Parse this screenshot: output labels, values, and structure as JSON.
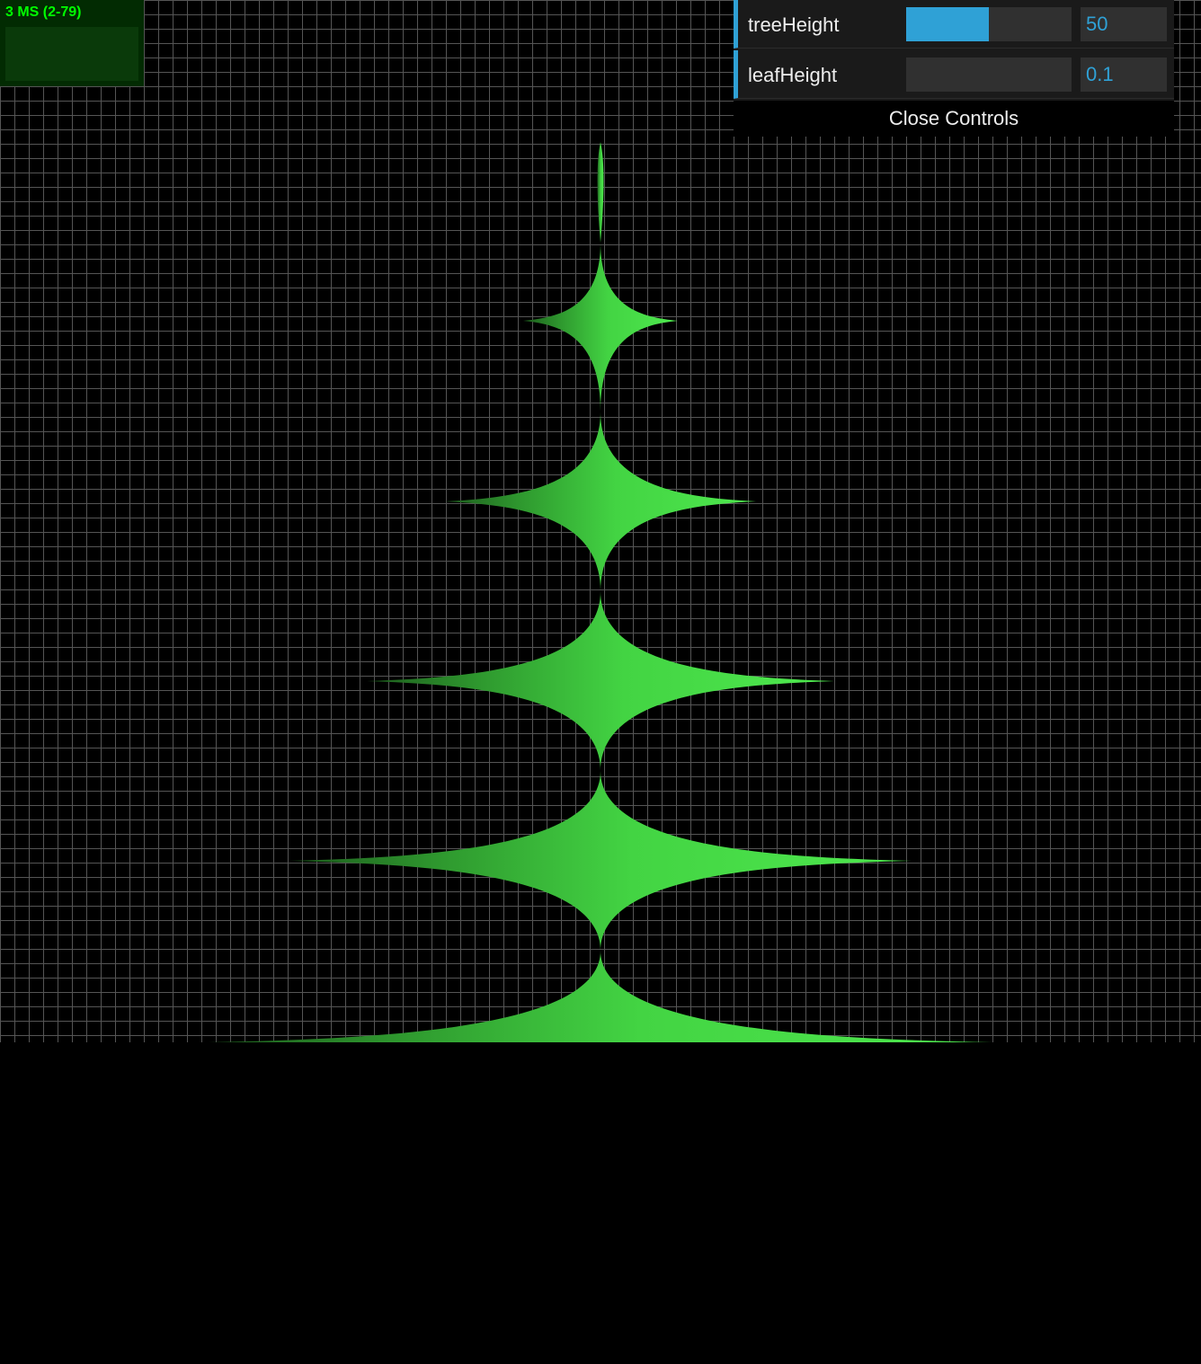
{
  "stats": {
    "label": "3 MS (2-79)"
  },
  "controls": {
    "rows": [
      {
        "label": "treeHeight",
        "value": "50",
        "fraction": 0.5
      },
      {
        "label": "leafHeight",
        "value": "0.1",
        "fraction": 0.0
      }
    ],
    "close_label": "Close Controls"
  },
  "colors": {
    "accent": "#2fa1d6",
    "leaf_light": "#4ee84e",
    "leaf_dark": "#1d5c1d",
    "stats_text": "#00ff00"
  }
}
